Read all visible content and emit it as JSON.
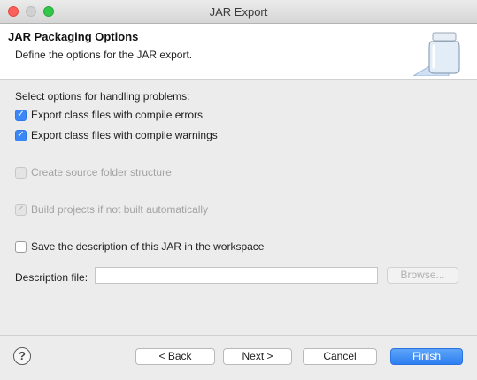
{
  "window": {
    "title": "JAR Export"
  },
  "header": {
    "title": "JAR Packaging Options",
    "description": "Define the options for the JAR export."
  },
  "options": {
    "section_label": "Select options for handling problems:",
    "export_errors": {
      "label": "Export class files with compile errors",
      "checked": true,
      "enabled": true
    },
    "export_warnings": {
      "label": "Export class files with compile warnings",
      "checked": true,
      "enabled": true
    },
    "source_folder": {
      "label": "Create source folder structure",
      "checked": false,
      "enabled": false
    },
    "build_projects": {
      "label": "Build projects if not built automatically",
      "checked": true,
      "enabled": false
    },
    "save_description": {
      "label": "Save the description of this JAR in the workspace",
      "checked": false,
      "enabled": true
    }
  },
  "description_file": {
    "label": "Description file:",
    "value": "",
    "browse_label": "Browse..."
  },
  "footer": {
    "help_glyph": "?",
    "back_label": "< Back",
    "next_label": "Next >",
    "cancel_label": "Cancel",
    "finish_label": "Finish"
  },
  "colors": {
    "accent": "#3b87f7",
    "finish_button": "#2d7ef2",
    "close_light": "#fc605b",
    "maximize_light": "#33c748"
  }
}
